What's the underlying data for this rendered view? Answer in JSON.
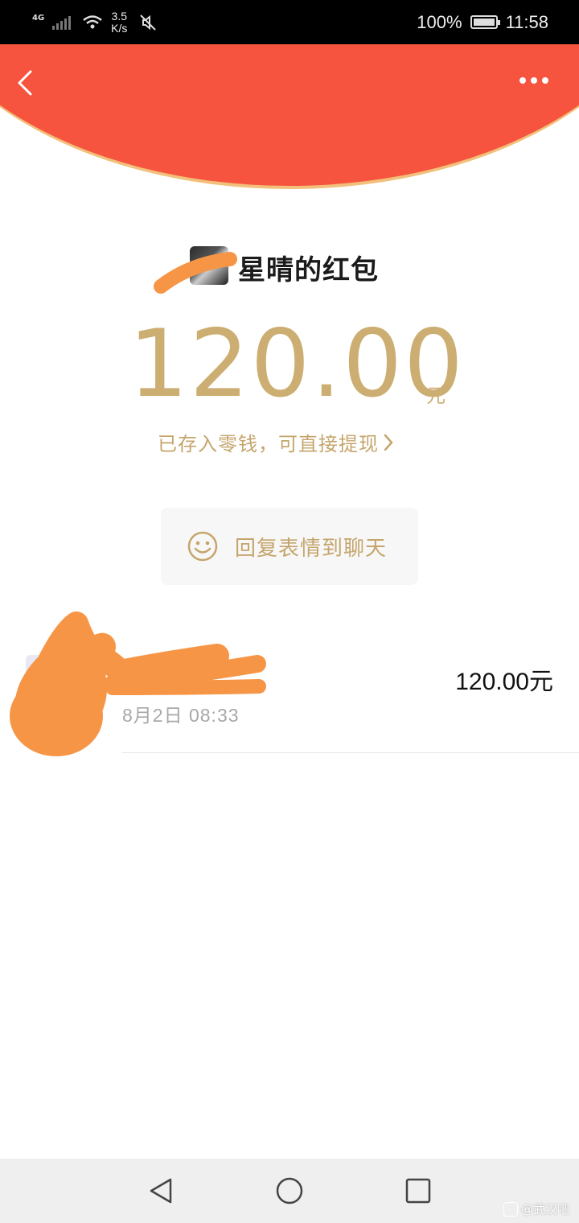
{
  "status_bar": {
    "network": "4G",
    "speed_value": "3.5",
    "speed_unit": "K/s",
    "battery": "100%",
    "time": "11:58"
  },
  "header": {
    "back_icon": "chevron-left-icon",
    "more_icon": "more-dots-icon",
    "color": "#F6543E"
  },
  "red_packet": {
    "sender_title": "星晴的红包",
    "amount": "120.00",
    "unit": "元",
    "wallet_note": "已存入零钱，可直接提现",
    "wallet_chevron": "›",
    "accent_color": "#CDAE72"
  },
  "reply": {
    "label": "回复表情到聊天",
    "icon": "smiley-icon"
  },
  "records": [
    {
      "time": "8月2日  08:33",
      "amount": "120.00元"
    }
  ],
  "watermark": {
    "text": "@武汉吧"
  },
  "nav": {
    "back": "triangle-back-icon",
    "home": "circle-home-icon",
    "recents": "square-recents-icon"
  }
}
